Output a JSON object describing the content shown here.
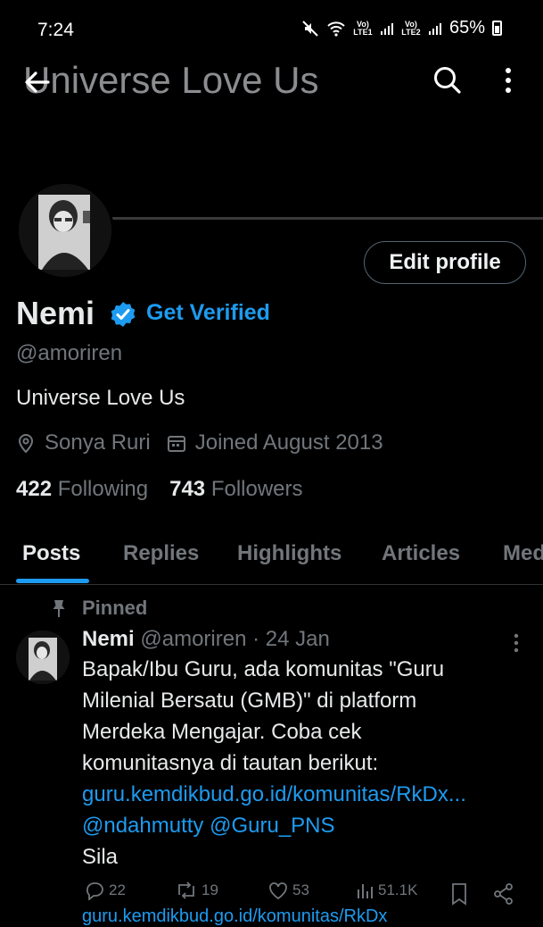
{
  "status_bar": {
    "time": "7:24",
    "lte1": "Vo) LTE1",
    "lte2": "Vo) LTE2",
    "battery": "65%"
  },
  "header": {
    "title": "Universe Love Us",
    "icons": [
      "back-arrow-icon",
      "search-icon",
      "more-vertical-icon"
    ]
  },
  "profile": {
    "edit_label": "Edit profile",
    "name": "Nemi",
    "get_verified": "Get Verified",
    "handle": "@amoriren",
    "bio": "Universe Love Us",
    "location": "Sonya Ruri",
    "joined": "Joined August 2013",
    "following_count": "422",
    "following_label": "Following",
    "followers_count": "743",
    "followers_label": "Followers"
  },
  "tabs": [
    "Posts",
    "Replies",
    "Highlights",
    "Articles",
    "Media"
  ],
  "post": {
    "pinned_label": "Pinned",
    "author": "Nemi",
    "handle": "@amoriren",
    "date": "· 24 Jan",
    "lines": [
      "Bapak/Ibu Guru, ada komunitas \"Guru",
      "Milenial Bersatu (GMB)\" di platform",
      "Merdeka Mengajar. Coba cek",
      "komunitasnya di tautan berikut:"
    ],
    "link": "guru.kemdikbud.go.id/komunitas/RkDx...",
    "mentions": "@ndahmutty @Guru_PNS",
    "last_line": "Sila",
    "replies": "22",
    "reposts": "19",
    "likes": "53",
    "views": "51.1K",
    "bleed_text": "guru.kemdikbud.go.id/komunitas/RkDx"
  },
  "colors": {
    "accent": "#1d9bf0",
    "muted": "#71767b",
    "text": "#e7e9ea",
    "background": "#000000"
  }
}
